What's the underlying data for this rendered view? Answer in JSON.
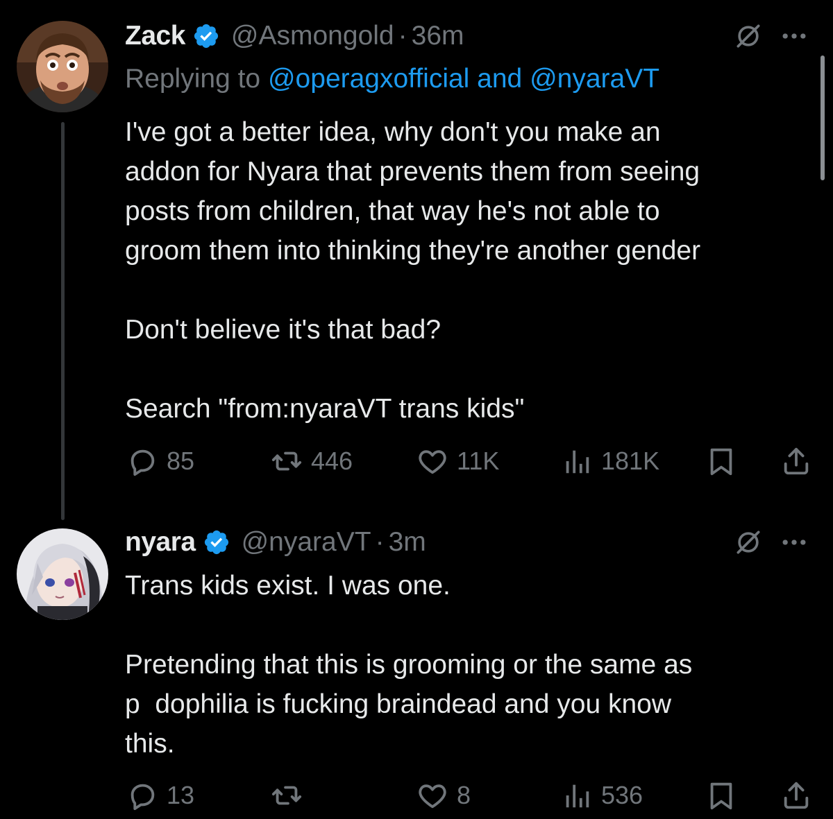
{
  "colors": {
    "background": "#000000",
    "text_primary": "#e7e9ea",
    "text_secondary": "#71767b",
    "link": "#1d9bf0",
    "verified": "#1d9bf0"
  },
  "tweets": [
    {
      "display_name": "Zack",
      "verified": true,
      "handle": "@Asmongold",
      "separator": "·",
      "time": "36m",
      "reply_prefix": "Replying to",
      "reply_to": "@operagxofficial and @nyaraVT",
      "text": "I've got a better idea, why don't you make an\naddon for Nyara that prevents them from seeing\nposts from children, that way he's not able to\ngroom them into thinking they're another gender\n\nDon't believe it's that bad?\n\nSearch \"from:nyaraVT trans kids\"",
      "stats": {
        "replies": "85",
        "retweets": "446",
        "likes": "11K",
        "views": "181K"
      },
      "icons": {
        "translate": "grok-icon",
        "more": "more-icon",
        "reply": "reply-icon",
        "retweet": "retweet-icon",
        "like": "heart-icon",
        "views": "views-icon",
        "bookmark": "bookmark-icon",
        "share": "share-icon"
      }
    },
    {
      "display_name": "nyara",
      "verified": true,
      "handle": "@nyaraVT",
      "separator": "·",
      "time": "3m",
      "text": "Trans kids exist. I was one.\n\nPretending that this is grooming or the same as\np  dophilia is fucking braindead and you know\nthis.",
      "stats": {
        "replies": "13",
        "retweets": "",
        "likes": "8",
        "views": "536"
      },
      "icons": {
        "translate": "grok-icon",
        "more": "more-icon",
        "reply": "reply-icon",
        "retweet": "retweet-icon",
        "like": "heart-icon",
        "views": "views-icon",
        "bookmark": "bookmark-icon",
        "share": "share-icon"
      }
    }
  ]
}
